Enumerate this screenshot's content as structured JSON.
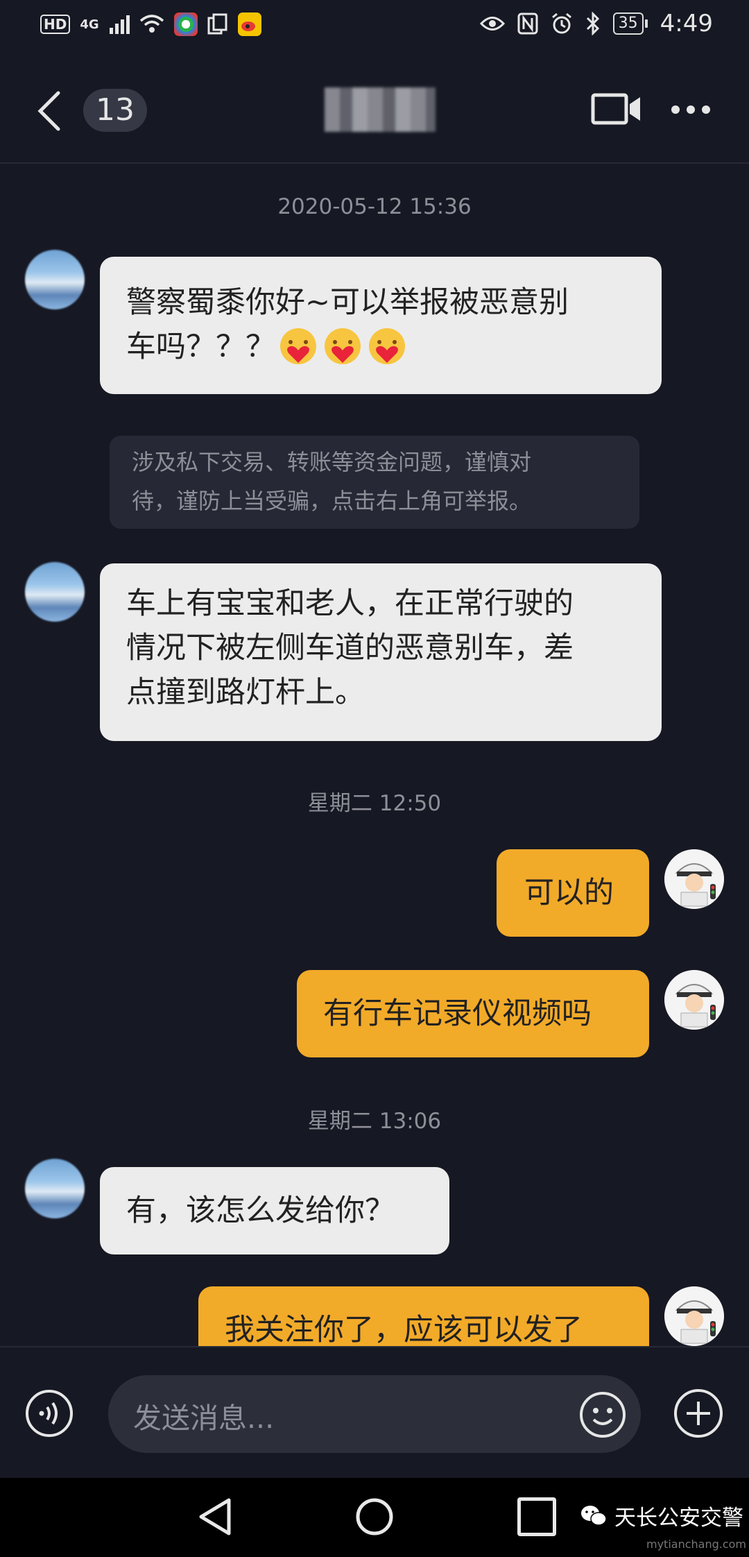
{
  "status_bar": {
    "left_badges": [
      "HD",
      "4G"
    ],
    "battery_level": "35",
    "time": "4:49"
  },
  "nav": {
    "unread_count": "13",
    "icons": [
      "back-icon",
      "video-call-icon",
      "more-icon"
    ]
  },
  "chat": {
    "messages": [
      {
        "type": "timestamp",
        "text": "2020-05-12 15:36"
      },
      {
        "type": "incoming",
        "line1": "警察蜀黍你好~可以举报被恶意别",
        "line2": "车吗？？？"
      },
      {
        "type": "notice",
        "line1": "涉及私下交易、转账等资金问题，谨慎对",
        "line2": "待，谨防上当受骗，点击右上角可举报。"
      },
      {
        "type": "incoming",
        "line1": "车上有宝宝和老人，在正常行驶的",
        "line2": "情况下被左侧车道的恶意别车，差",
        "line3": "点撞到路灯杆上。"
      },
      {
        "type": "timestamp",
        "text": "星期二 12:50"
      },
      {
        "type": "outgoing",
        "text": "可以的"
      },
      {
        "type": "outgoing",
        "text": "有行车记录仪视频吗"
      },
      {
        "type": "timestamp",
        "text": "星期二 13:06"
      },
      {
        "type": "incoming",
        "text": "有，该怎么发给你？"
      },
      {
        "type": "outgoing",
        "text": "我关注你了，应该可以发了"
      }
    ]
  },
  "input": {
    "placeholder": "发送消息..."
  },
  "watermark": {
    "text": "天长公安交警",
    "sub": "mytianchang.com"
  },
  "colors": {
    "background": "#161823",
    "outgoing_bubble": "#f2aa29",
    "incoming_bubble": "#ececec"
  }
}
